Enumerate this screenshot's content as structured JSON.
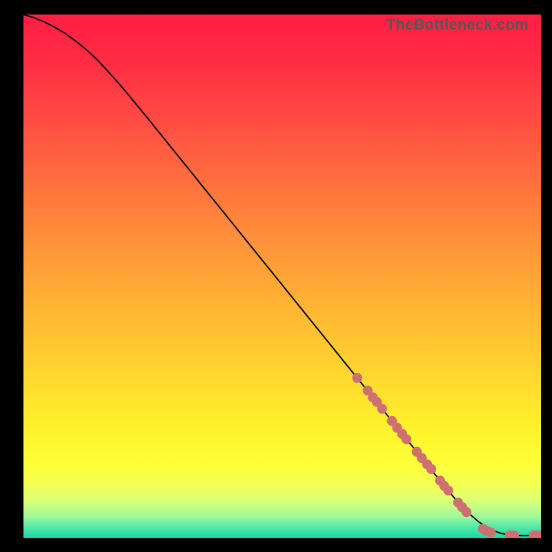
{
  "watermark": "TheBottleneck.com",
  "colors": {
    "dot": "#cf7070",
    "curve": "#000000"
  },
  "chart_data": {
    "type": "line",
    "title": "",
    "xlabel": "",
    "ylabel": "",
    "xlim": [
      0,
      100
    ],
    "ylim": [
      0,
      100
    ],
    "grid": false,
    "legend_position": "none",
    "annotations": [
      "TheBottleneck.com"
    ],
    "series": [
      {
        "name": "curve",
        "style": "line",
        "x": [
          0,
          2,
          4,
          6,
          8,
          10,
          12,
          14,
          16,
          18,
          20,
          24,
          28,
          32,
          36,
          40,
          44,
          48,
          52,
          56,
          60,
          64,
          68,
          72,
          76,
          80,
          84,
          86,
          88,
          90,
          92,
          94,
          96,
          98,
          100
        ],
        "y": [
          100,
          99.4,
          98.6,
          97.6,
          96.4,
          95.0,
          93.4,
          91.6,
          89.5,
          87.3,
          85.0,
          80.2,
          75.3,
          70.4,
          65.5,
          60.6,
          55.7,
          50.8,
          45.9,
          41.0,
          36.1,
          31.2,
          26.3,
          21.4,
          16.5,
          11.6,
          6.8,
          4.8,
          3.1,
          1.8,
          1.0,
          0.6,
          0.5,
          0.5,
          0.5
        ]
      },
      {
        "name": "highlighted-points",
        "style": "dots",
        "x": [
          64.5,
          66.5,
          67.5,
          68.3,
          69.3,
          71.2,
          72.2,
          73.2,
          74.0,
          76.0,
          77.0,
          78.0,
          78.8,
          80.5,
          81.3,
          82.1,
          84.0,
          84.8,
          85.6,
          88.8,
          89.5,
          90.3,
          94.0,
          94.8,
          98.6,
          99.4
        ],
        "y": [
          30.6,
          28.2,
          26.9,
          26.0,
          24.7,
          22.4,
          21.1,
          19.9,
          18.9,
          16.5,
          15.3,
          14.1,
          13.2,
          11.0,
          10.0,
          9.1,
          6.8,
          5.9,
          5.0,
          1.8,
          1.4,
          1.1,
          0.55,
          0.55,
          0.55,
          0.6
        ]
      }
    ]
  }
}
